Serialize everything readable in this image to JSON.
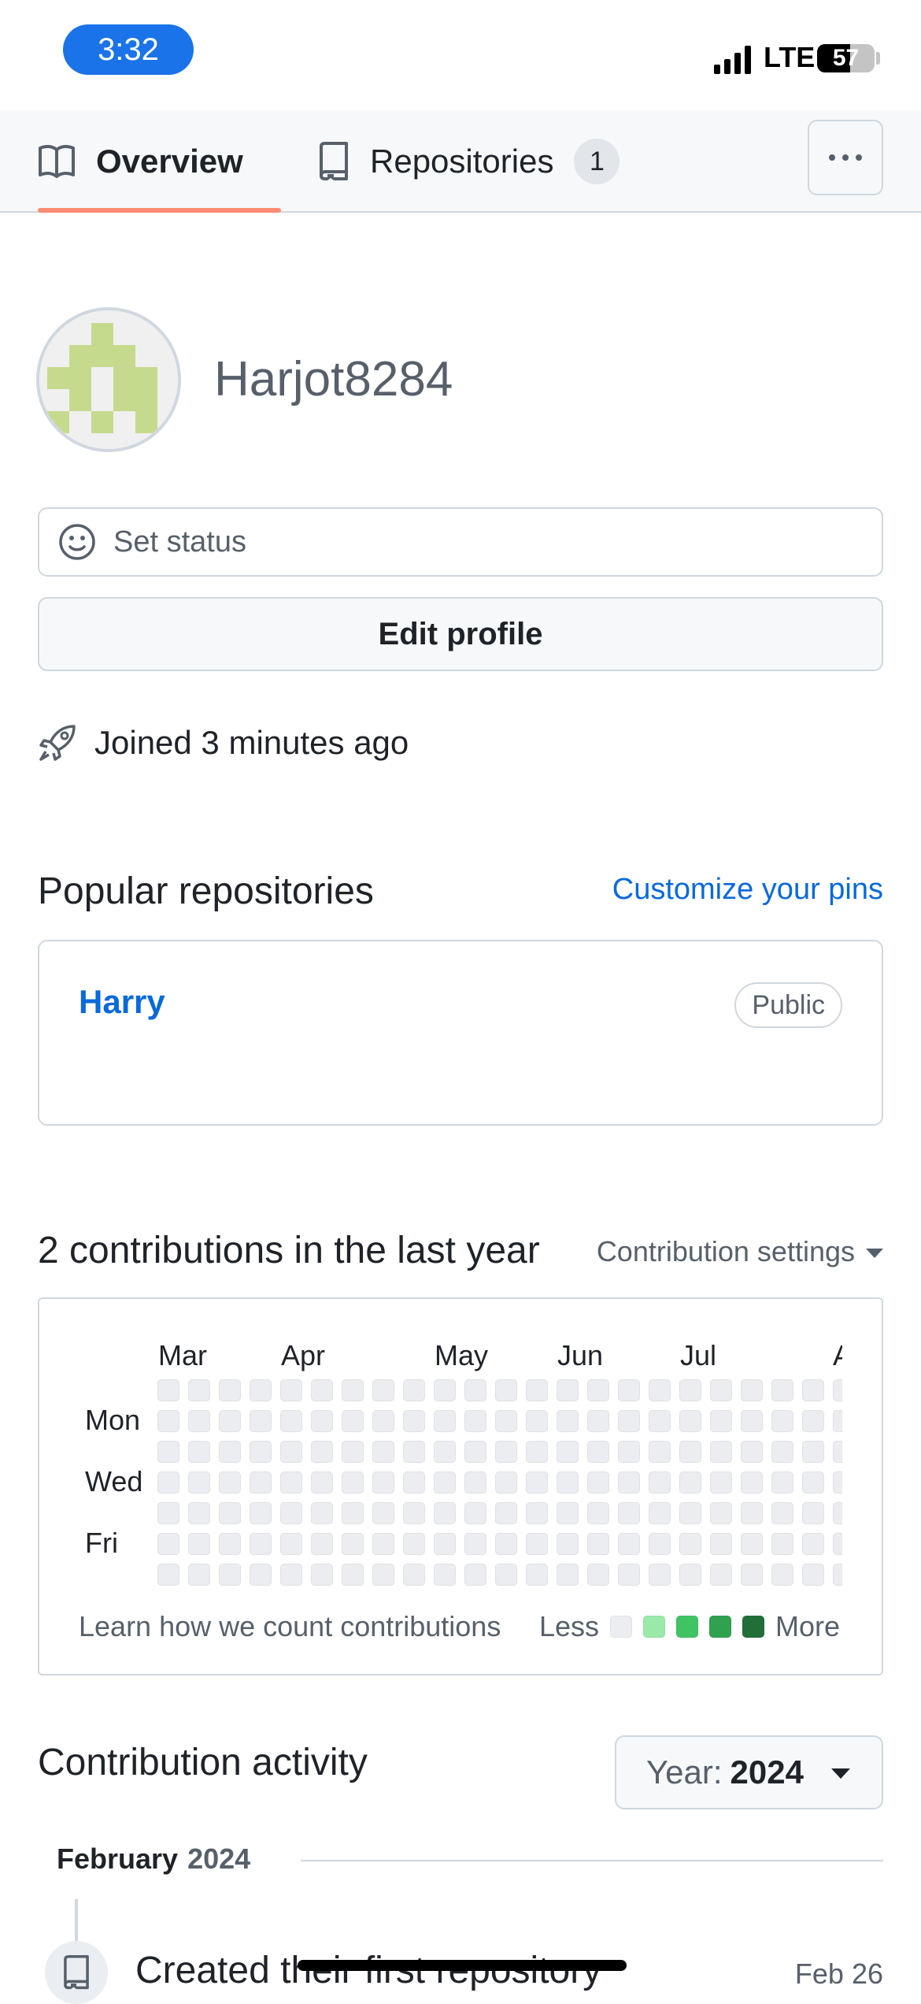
{
  "status_bar": {
    "time": "3:32",
    "network": "LTE",
    "battery": "57"
  },
  "tabs": {
    "overview": "Overview",
    "repositories": "Repositories",
    "repositories_count": "1"
  },
  "profile": {
    "username": "Harjot8284",
    "set_status": "Set status",
    "edit_profile": "Edit profile",
    "joined": "Joined 3 minutes ago"
  },
  "popular": {
    "title": "Popular repositories",
    "customize": "Customize your pins",
    "repo_name": "Harry",
    "repo_visibility": "Public"
  },
  "contributions": {
    "title": "2 contributions in the last year",
    "settings": "Contribution settings",
    "months": [
      "Mar",
      "Apr",
      "May",
      "Jun",
      "Jul",
      "A"
    ],
    "days": [
      "Mon",
      "Wed",
      "Fri"
    ],
    "learn": "Learn how we count contributions",
    "less": "Less",
    "more": "More",
    "legend_colors": [
      "#ebedf0",
      "#9be9a8",
      "#40c463",
      "#30a14e",
      "#216e39"
    ],
    "cell_color": "#ebedf0"
  },
  "activity": {
    "title": "Contribution activity",
    "year_label": "Year:",
    "year_value": "2024",
    "month": "February",
    "month_year": "2024",
    "event_text": "Created their first repository",
    "event_date": "Feb 26"
  },
  "colors": {
    "accent_link": "#0969da",
    "tab_underline": "#fd8c73",
    "status_time_bg": "#1a73e8",
    "avatar_fg": "#c6da8e"
  },
  "icons": [
    "book-icon",
    "repo-icon",
    "kebab-icon",
    "smiley-icon",
    "rocket-icon",
    "caret-down-icon",
    "repo-event-icon"
  ]
}
